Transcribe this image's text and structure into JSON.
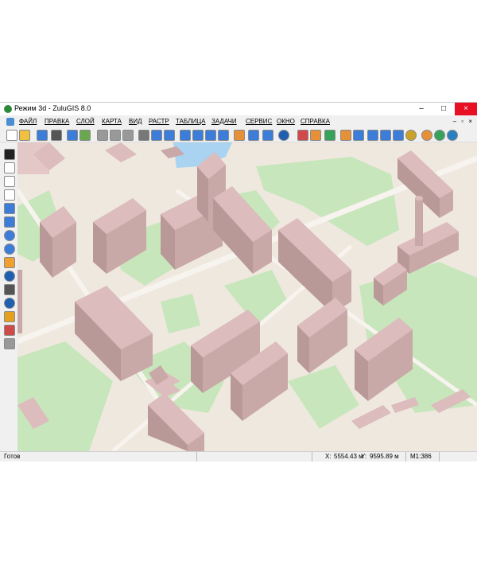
{
  "window": {
    "title": "Режим 3d - ZuluGIS 8.0",
    "minimize_glyph": "–",
    "maximize_glyph": "□",
    "close_glyph": "×"
  },
  "menu": {
    "items": [
      "ФАЙЛ",
      "ПРАВКА",
      "СЛОЙ",
      "КАРТА",
      "ВИД",
      "РАСТР",
      "ТАБЛИЦА",
      "ЗАДАЧИ",
      "СЕРВИС",
      "ОКНО",
      "СПРАВКА"
    ],
    "mdi_controls": "– ▫ ×"
  },
  "toolbar": {
    "icons": [
      "new-icon",
      "open-icon",
      "save-icon",
      "print-icon",
      "preview-icon",
      "export-icon",
      "cut-icon",
      "copy-icon",
      "paste-icon",
      "delete-icon",
      "undo-icon",
      "redo-icon",
      "table-icon",
      "layers-icon",
      "grid-icon",
      "add-icon",
      "edit-icon",
      "calendar-icon",
      "query-icon",
      "help-icon",
      "network-icon",
      "pipe-icon",
      "valve-icon",
      "pump-icon",
      "profile-icon",
      "flow-icon",
      "sewer-icon",
      "heat-icon",
      "gas-icon",
      "water-icon",
      "elec-icon",
      "info-icon"
    ]
  },
  "left_tools": {
    "icons": [
      "select-arrow-icon",
      "select-rect-icon",
      "select-poly-icon",
      "select-circle-icon",
      "select-layer-icon",
      "fit-icon",
      "zoom-in-icon",
      "zoom-out-icon",
      "pan-hand-icon",
      "info-icon",
      "find-icon",
      "navigate-icon",
      "label-icon",
      "flag-icon",
      "node-icon"
    ]
  },
  "status": {
    "text": "Готов",
    "x_label": "X:",
    "x_value": "5554.43 м",
    "y_label": "Y:",
    "y_value": "9595.89 м",
    "scale": "M1:386"
  },
  "colors": {
    "map_bg": "#efe8df",
    "green": "#c8e6bb",
    "building_roof": "#dcbcbc",
    "building_wall": "#b99898",
    "water": "#a9d3f0"
  }
}
